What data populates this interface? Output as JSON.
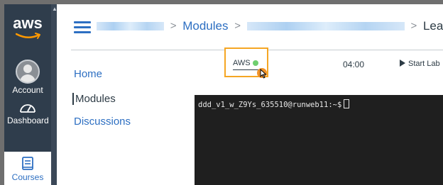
{
  "global_nav": {
    "logo_text": "aws",
    "items": [
      {
        "label": "Account",
        "icon": "avatar-icon"
      },
      {
        "label": "Dashboard",
        "icon": "dashboard-icon"
      },
      {
        "label": "Courses",
        "icon": "courses-book-icon"
      }
    ]
  },
  "breadcrumb": {
    "items": [
      {
        "label": "",
        "blurred": true
      },
      {
        "label": "Modules",
        "blurred": false
      },
      {
        "label": "",
        "blurred": true
      },
      {
        "label": "Learner",
        "blurred": false
      }
    ],
    "separator": ">"
  },
  "course_nav": {
    "items": [
      {
        "label": "Home",
        "active": false
      },
      {
        "label": "Modules",
        "active": true
      },
      {
        "label": "Discussions",
        "active": false
      }
    ]
  },
  "lab": {
    "aws_label": "AWS",
    "aws_status_color": "#6fcf6f",
    "timer": "04:00",
    "start_label": "Start Lab",
    "highlight_color": "#f5a623"
  },
  "terminal": {
    "prompt": "ddd_v1_w_Z9Ys_635510@runweb11:~$"
  },
  "colors": {
    "nav_bg": "#2f3d4c",
    "link": "#2d6fc2",
    "terminal_bg": "#1f1f1f"
  }
}
